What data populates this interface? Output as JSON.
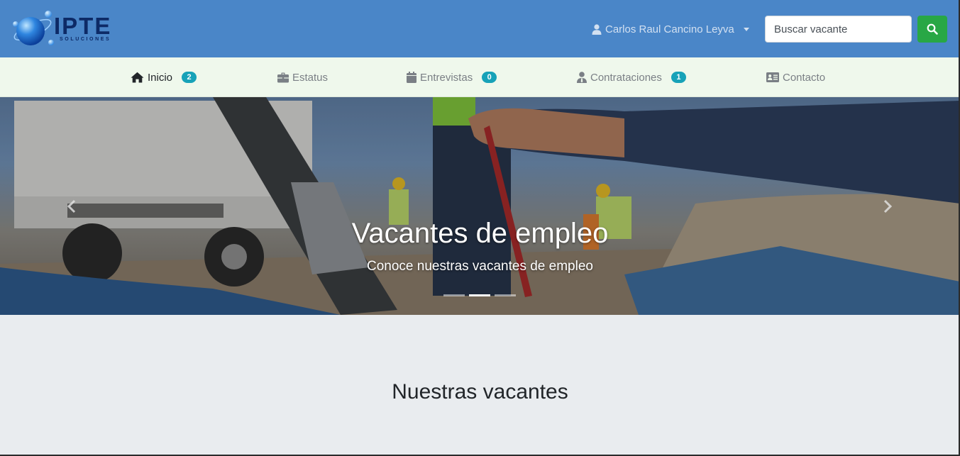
{
  "brand": {
    "name": "IPTE",
    "tagline": "SOLUCIONES"
  },
  "header": {
    "user_name": "Carlos Raul Cancino Leyva",
    "search_placeholder": "Buscar vacante"
  },
  "nav": {
    "items": [
      {
        "label": "Inicio",
        "badge": "2",
        "icon": "home-icon"
      },
      {
        "label": "Estatus",
        "icon": "briefcase-icon"
      },
      {
        "label": "Entrevistas",
        "badge": "0",
        "icon": "calendar-icon"
      },
      {
        "label": "Contrataciones",
        "badge": "1",
        "icon": "user-tie-icon"
      },
      {
        "label": "Contacto",
        "icon": "address-card-icon"
      }
    ]
  },
  "carousel": {
    "title": "Vacantes de empleo",
    "subtitle": "Conoce nuestras vacantes de empleo",
    "active_index": 1,
    "slide_count": 3
  },
  "section": {
    "title": "Nuestras vacantes"
  },
  "colors": {
    "header_bg": "#4a86c8",
    "subnav_bg": "#eff8ec",
    "badge": "#17a2b8",
    "search_button": "#28a745",
    "page_bg": "#e9ecef"
  }
}
